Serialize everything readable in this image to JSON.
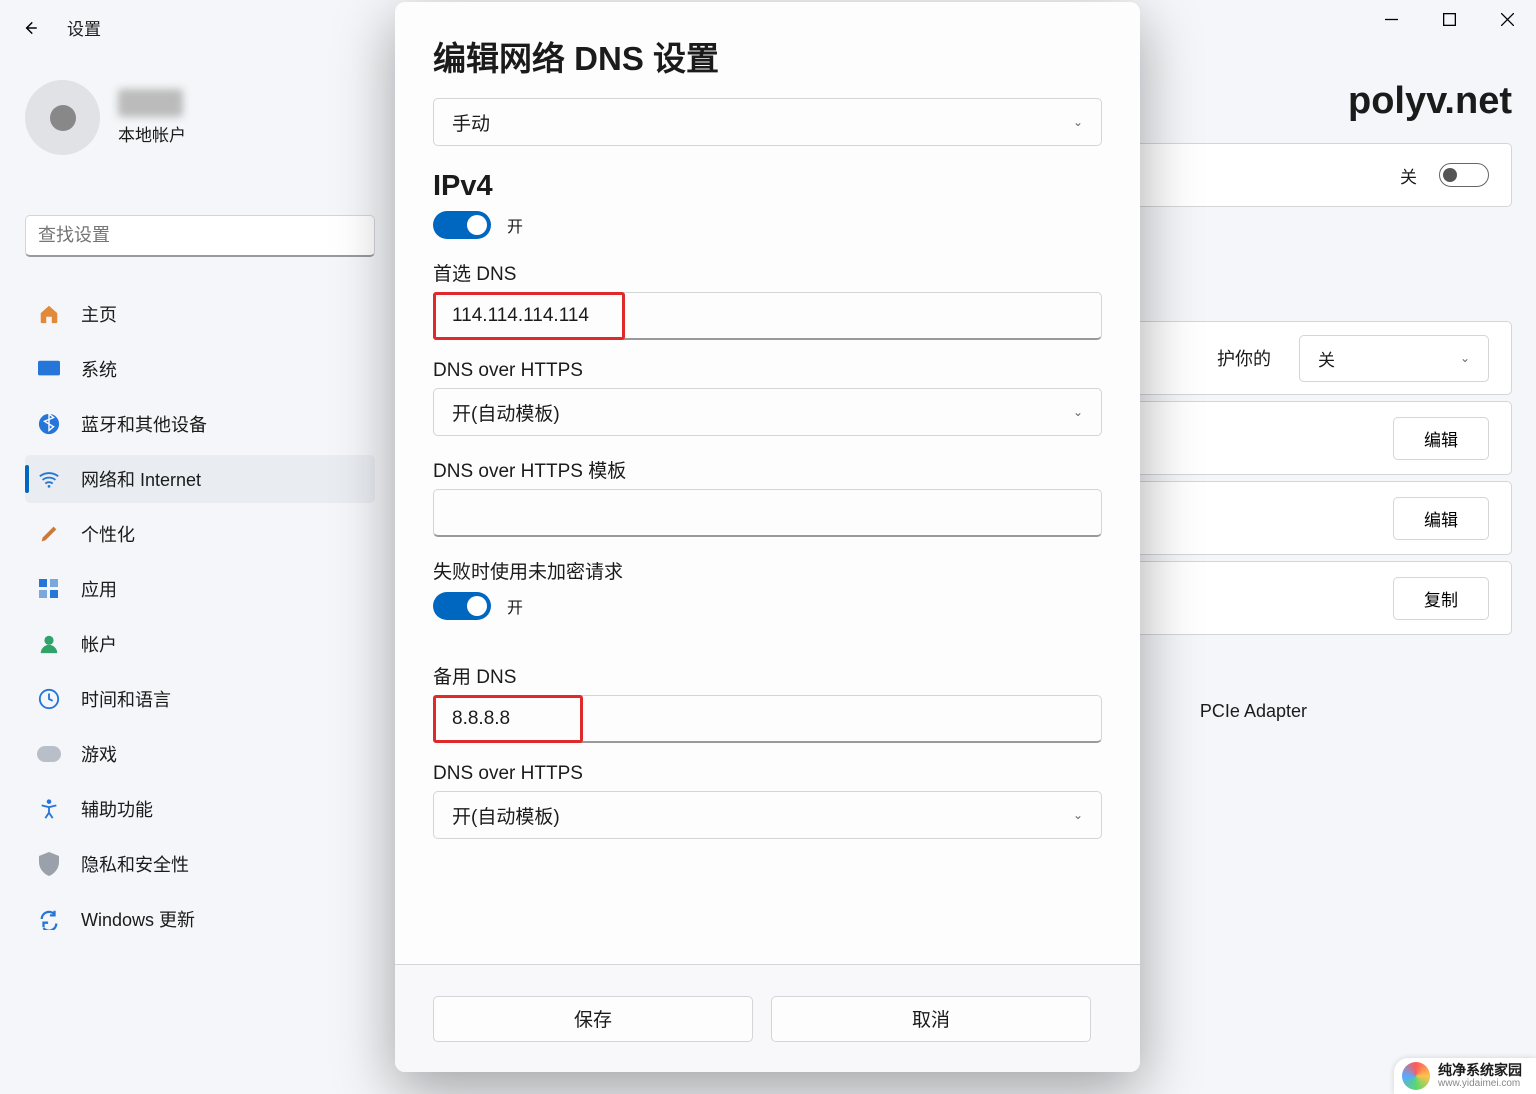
{
  "window": {
    "minimize": "−",
    "maximize": "☐",
    "close": "✕"
  },
  "header": {
    "settings": "设置"
  },
  "profile": {
    "account_type": "本地帐户"
  },
  "search": {
    "placeholder": "查找设置"
  },
  "sidebar": {
    "items": [
      {
        "icon": "home-icon",
        "label": "主页",
        "active": false
      },
      {
        "icon": "system-icon",
        "label": "系统",
        "active": false
      },
      {
        "icon": "bluetooth-icon",
        "label": "蓝牙和其他设备",
        "active": false
      },
      {
        "icon": "network-icon",
        "label": "网络和 Internet",
        "active": true
      },
      {
        "icon": "personalize-icon",
        "label": "个性化",
        "active": false
      },
      {
        "icon": "apps-icon",
        "label": "应用",
        "active": false
      },
      {
        "icon": "accounts-icon",
        "label": "帐户",
        "active": false
      },
      {
        "icon": "time-language-icon",
        "label": "时间和语言",
        "active": false
      },
      {
        "icon": "gaming-icon",
        "label": "游戏",
        "active": false
      },
      {
        "icon": "accessibility-icon",
        "label": "辅助功能",
        "active": false
      },
      {
        "icon": "privacy-icon",
        "label": "隐私和安全性",
        "active": false
      },
      {
        "icon": "windowsupdate-icon",
        "label": "Windows 更新",
        "active": false
      }
    ]
  },
  "page_bg": {
    "heading_partial": "polyv.net",
    "toggle_off_label": "关",
    "desc_fragment": "护你的",
    "select_value": "关",
    "btn_edit": "编辑",
    "btn_copy": "复制",
    "adapter_fragment": "PCIe Adapter"
  },
  "dialog": {
    "title": "编辑网络 DNS 设置",
    "mode_label": "手动",
    "ipv4_heading": "IPv4",
    "toggle_on_label": "开",
    "preferred_dns_label": "首选 DNS",
    "preferred_dns_value": "114.114.114.114",
    "doh_label": "DNS over HTTPS",
    "doh_value": "开(自动模板)",
    "doh_template_label": "DNS over HTTPS 模板",
    "doh_template_value": "",
    "fallback_label": "失败时使用未加密请求",
    "alt_dns_label": "备用 DNS",
    "alt_dns_value": "8.8.8.8",
    "save": "保存",
    "cancel": "取消"
  },
  "watermark": {
    "line1": "纯净系统家园",
    "line2": "www.yidaimei.com"
  }
}
